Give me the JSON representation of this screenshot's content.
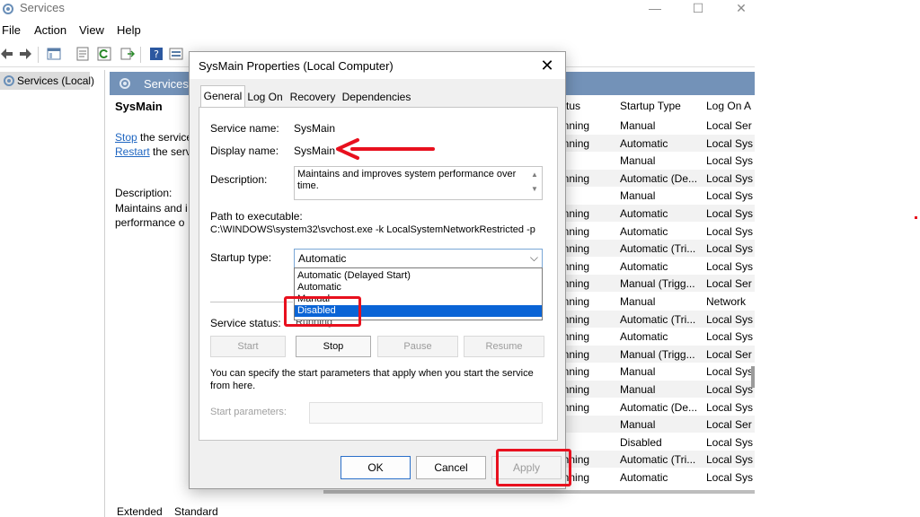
{
  "window": {
    "title": "Services",
    "minimize": "—",
    "maximize": "☐",
    "close": "✕"
  },
  "menu": [
    "File",
    "Action",
    "View",
    "Help"
  ],
  "toolbar_icons": [
    "back-icon",
    "forward-icon",
    "console-tree-icon",
    "properties-icon",
    "refresh-icon",
    "export-icon",
    "help-icon",
    "view-icon"
  ],
  "tree": {
    "root": "Services (Local)"
  },
  "content": {
    "header": "Services (",
    "selected_service": "SysMain",
    "stop_link": "Stop",
    "stop_text": " the service",
    "restart_link": "Restart",
    "restart_text": " the serv",
    "description_label": "Description:",
    "description_lines": [
      "Maintains and i",
      "performance o"
    ]
  },
  "columns": {
    "status": "tatus",
    "startup_type": "Startup Type",
    "log_on": "Log On A"
  },
  "rows": [
    {
      "status": "unning",
      "type": "Manual",
      "logon": "Local Ser"
    },
    {
      "status": "unning",
      "type": "Automatic",
      "logon": "Local Sys"
    },
    {
      "status": "",
      "type": "Manual",
      "logon": "Local Sys"
    },
    {
      "status": "unning",
      "type": "Automatic (De...",
      "logon": "Local Sys"
    },
    {
      "status": "",
      "type": "Manual",
      "logon": "Local Sys"
    },
    {
      "status": "unning",
      "type": "Automatic",
      "logon": "Local Sys"
    },
    {
      "status": "unning",
      "type": "Automatic",
      "logon": "Local Sys"
    },
    {
      "status": "unning",
      "type": "Automatic (Tri...",
      "logon": "Local Sys"
    },
    {
      "status": "unning",
      "type": "Automatic",
      "logon": "Local Sys"
    },
    {
      "status": "unning",
      "type": "Manual (Trigg...",
      "logon": "Local Ser"
    },
    {
      "status": "unning",
      "type": "Manual",
      "logon": "Network"
    },
    {
      "status": "unning",
      "type": "Automatic (Tri...",
      "logon": "Local Sys"
    },
    {
      "status": "unning",
      "type": "Automatic",
      "logon": "Local Sys"
    },
    {
      "status": "unning",
      "type": "Manual (Trigg...",
      "logon": "Local Ser"
    },
    {
      "status": "unning",
      "type": "Manual",
      "logon": "Local Sys"
    },
    {
      "status": "unning",
      "type": "Manual",
      "logon": "Local Sys"
    },
    {
      "status": "unning",
      "type": "Automatic (De...",
      "logon": "Local Sys"
    },
    {
      "status": "",
      "type": "Manual",
      "logon": "Local Ser"
    },
    {
      "status": "",
      "type": "Disabled",
      "logon": "Local Sys"
    },
    {
      "status": "unning",
      "type": "Automatic (Tri...",
      "logon": "Local Sys"
    },
    {
      "status": "unning",
      "type": "Automatic",
      "logon": "Local Sys"
    }
  ],
  "bottom_tabs": [
    "Extended",
    "Standard"
  ],
  "dialog": {
    "title": "SysMain Properties (Local Computer)",
    "tabs": [
      "General",
      "Log On",
      "Recovery",
      "Dependencies"
    ],
    "service_name_label": "Service name:",
    "service_name": "SysMain",
    "display_name_label": "Display name:",
    "display_name": "SysMain",
    "description_label": "Description:",
    "description": "Maintains and improves system performance over time.",
    "path_label": "Path to executable:",
    "path": "C:\\WINDOWS\\system32\\svchost.exe -k LocalSystemNetworkRestricted -p",
    "startup_type_label": "Startup type:",
    "startup_type_value": "Automatic",
    "startup_options": [
      "Automatic (Delayed Start)",
      "Automatic",
      "Manual",
      "Disabled"
    ],
    "selected_option_index": 3,
    "service_status_label": "Service status:",
    "service_status": "Running",
    "start_button": "Start",
    "stop_button": "Stop",
    "pause_button": "Pause",
    "resume_button": "Resume",
    "help_text_1": "You can specify the start parameters that apply when you start the service",
    "help_text_2": "from here.",
    "start_params_label": "Start parameters:",
    "ok_button": "OK",
    "cancel_button": "Cancel",
    "apply_button": "Apply"
  },
  "colors": {
    "annotation": "#e8101e",
    "header_bar": "#7392b8",
    "selection": "#0a64d6"
  }
}
